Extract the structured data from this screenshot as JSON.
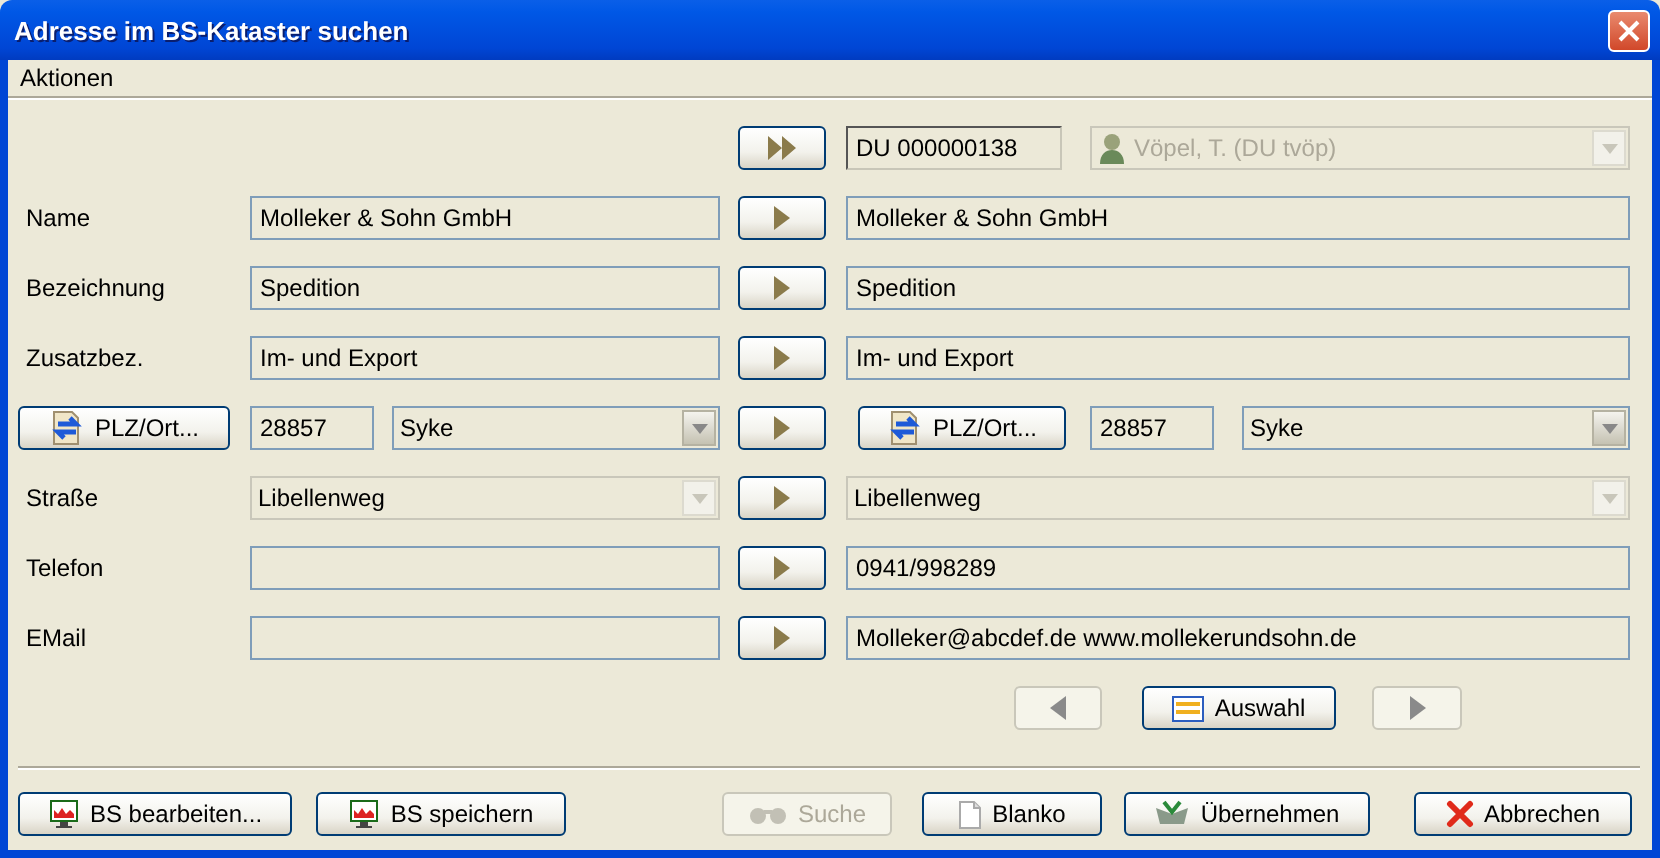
{
  "window": {
    "title": "Adresse im BS-Kataster suchen"
  },
  "menu": [
    {
      "label": "Aktionen"
    }
  ],
  "header": {
    "record_id": "DU 000000138",
    "user": {
      "value": "Vöpel, T. (DU tvöp)",
      "disabled": true
    }
  },
  "rows": [
    {
      "kind": "text",
      "label": "Name",
      "left": "Molleker & Sohn GmbH",
      "right": "Molleker & Sohn GmbH"
    },
    {
      "kind": "text",
      "label": "Bezeichnung",
      "left": "Spedition",
      "right": "Spedition"
    },
    {
      "kind": "text",
      "label": "Zusatzbez.",
      "left": "Im- und Export",
      "right": "Im- und Export"
    },
    {
      "kind": "plz",
      "left": {
        "button": "PLZ/Ort...",
        "zip": "28857",
        "city": "Syke",
        "disabled": false
      },
      "right": {
        "button": "PLZ/Ort...",
        "zip": "28857",
        "city": "Syke",
        "disabled": false
      }
    },
    {
      "kind": "combo",
      "label": "Straße",
      "left": {
        "value": "Libellenweg",
        "disabled": true
      },
      "right": {
        "value": "Libellenweg",
        "disabled": true
      }
    },
    {
      "kind": "text",
      "label": "Telefon",
      "right": "0941/998289"
    },
    {
      "kind": "text",
      "label": "EMail",
      "right": "Molleker@abcdef.de www.mollekerundsohn.de"
    }
  ],
  "navigation": {
    "previous": {
      "disabled": true
    },
    "select": {
      "label": "Auswahl"
    },
    "next": {
      "disabled": true
    }
  },
  "footer": {
    "left": [
      {
        "label": "BS bearbeiten...",
        "disabled": false
      },
      {
        "label": "BS speichern",
        "disabled": false
      }
    ],
    "right": [
      {
        "label": "Suche",
        "disabled": true
      },
      {
        "label": "Blanko",
        "disabled": false
      },
      {
        "label": "Übernehmen",
        "disabled": false
      },
      {
        "label": "Abbrechen",
        "disabled": false
      }
    ]
  }
}
